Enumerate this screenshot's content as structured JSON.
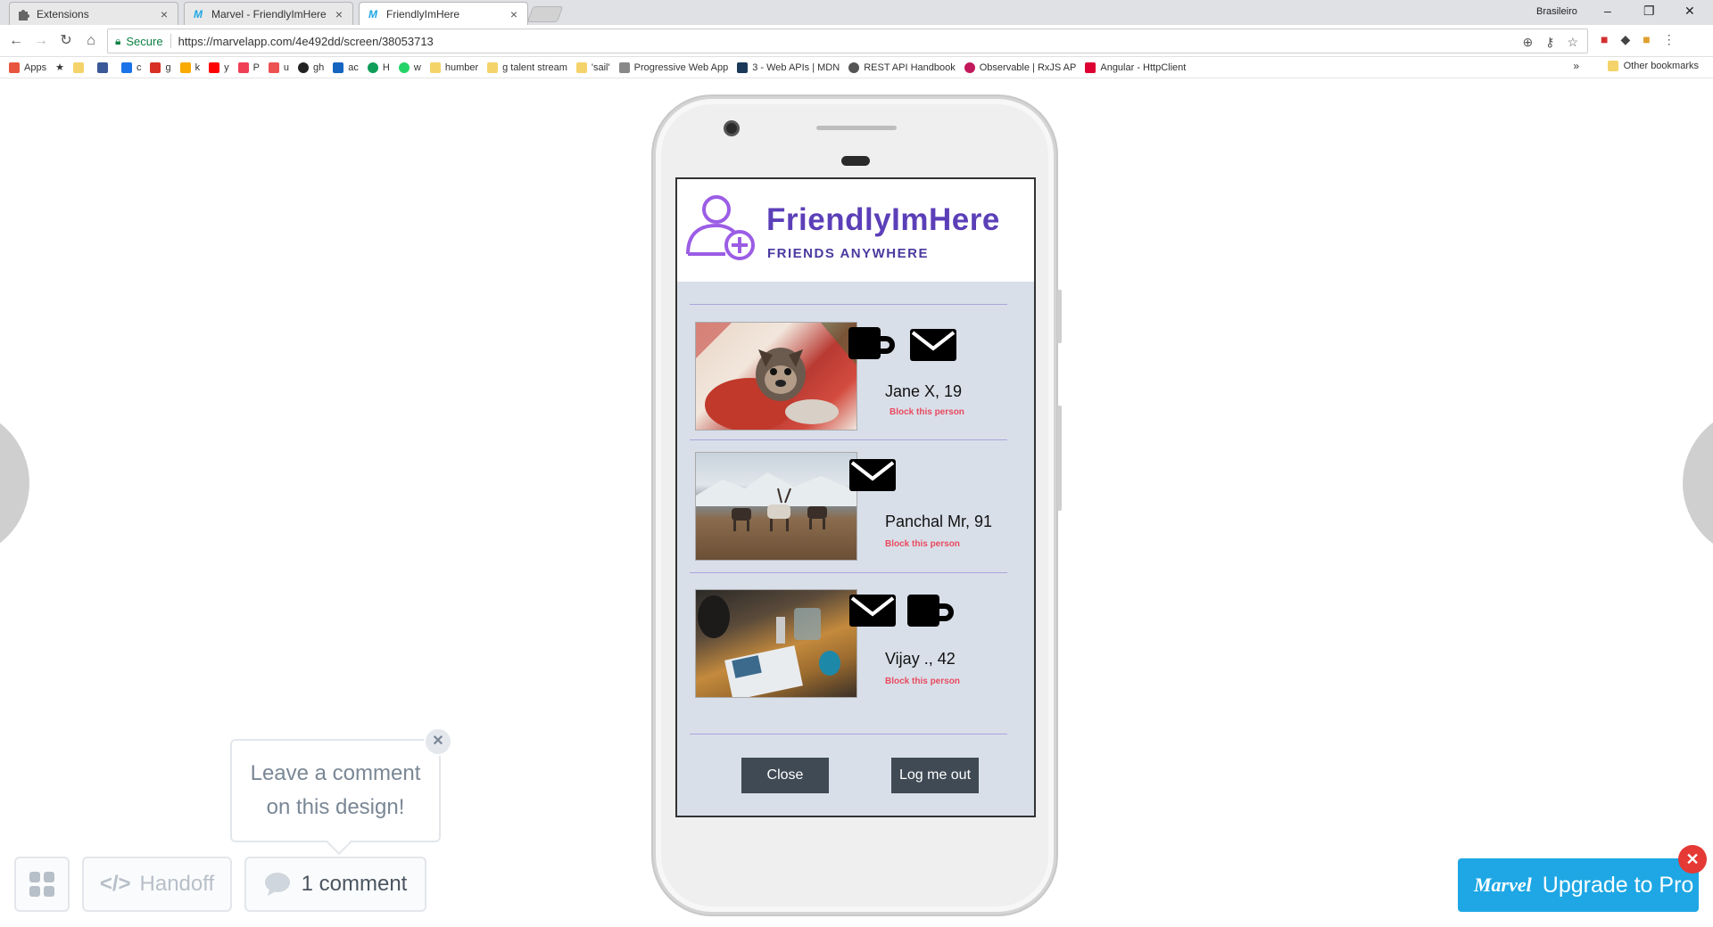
{
  "browser": {
    "tabs": [
      {
        "label": "Extensions",
        "icon": "puzzle-icon"
      },
      {
        "label": "Marvel - FriendlyImHere",
        "icon": "marvel-icon"
      },
      {
        "label": "FriendlyImHere",
        "icon": "marvel-icon"
      }
    ],
    "profile_name": "Brasileiro",
    "security_label": "Secure",
    "url": "https://marvelapp.com/4e492dd/screen/38053713",
    "bookmarks": [
      "Apps",
      "c",
      "g",
      "k",
      "y",
      "P",
      "u",
      "gh",
      "ac",
      "H",
      "w",
      "humber",
      "g talent stream",
      "'sail'",
      "Progressive Web App",
      "3 - Web APIs | MDN",
      "REST API Handbook",
      "Observable | RxJS AP",
      "Angular - HttpClient"
    ],
    "bookmarks_overflow": "»",
    "other_bookmarks": "Other bookmarks"
  },
  "app": {
    "title": "FriendlyImHere",
    "subtitle": "FRIENDS ANYWHERE",
    "colors": {
      "brand": "#5b3fb8",
      "background": "#d9dfe9",
      "block_link": "#e84a5f",
      "button": "#3f4a54"
    },
    "friends": [
      {
        "name": "Jane X, 19",
        "block_label": "Block this person",
        "photo": "french-bulldog-christmas",
        "icons": [
          "coffee-mug-icon",
          "envelope-icon"
        ]
      },
      {
        "name": "Panchal Mr, 91",
        "block_label": "Block this person",
        "photo": "reindeer-snowy-field",
        "icons": [
          "envelope-icon"
        ]
      },
      {
        "name": "Vijay ., 42",
        "block_label": "Block this person",
        "photo": "cafe-table-drawing",
        "icons": [
          "envelope-icon",
          "coffee-mug-icon"
        ]
      }
    ],
    "close_label": "Close",
    "logout_label": "Log me out"
  },
  "marvel": {
    "comment_prompt_line1": "Leave a comment",
    "comment_prompt_line2": "on this design!",
    "handoff_label": "Handoff",
    "comments_label": "1 comment",
    "upgrade_logo": "Marvel",
    "upgrade_label": "Upgrade to Pro"
  }
}
